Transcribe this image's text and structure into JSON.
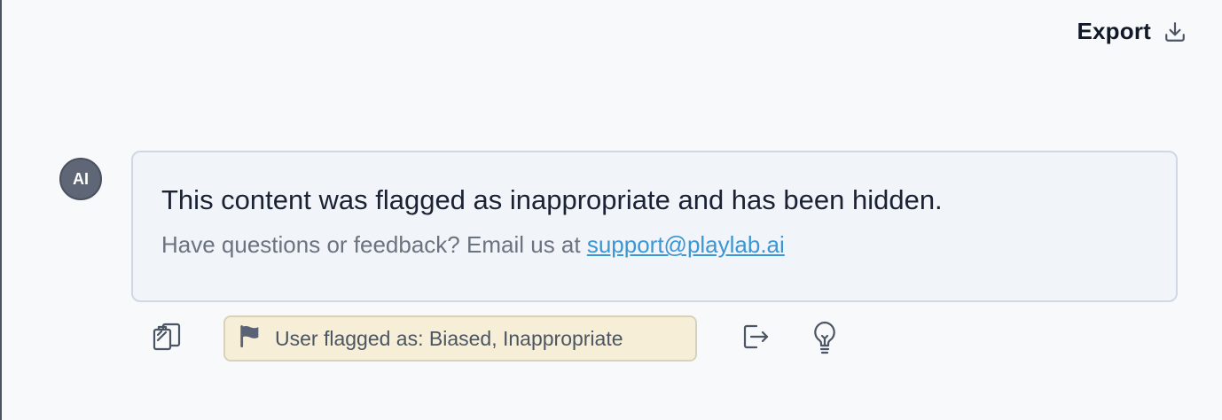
{
  "header": {
    "export_label": "Export",
    "export_icon": "download-icon"
  },
  "message": {
    "avatar_label": "AI",
    "main_text": "This content was flagged as inappropriate and has been hidden.",
    "sub_prefix": "Have questions or feedback? Email us at ",
    "support_email": "support@playlab.ai"
  },
  "actions": {
    "copy_icon": "clipboard-icon",
    "flag_icon": "flag-icon",
    "flag_text": "User flagged as: Biased, Inappropriate",
    "share_icon": "open-in-icon",
    "idea_icon": "lightbulb-icon"
  },
  "colors": {
    "background": "#f8f9fb",
    "card_background": "#f1f4f9",
    "card_border": "#cfd8e3",
    "avatar": "#5f6676",
    "link": "#3b96d4",
    "flag_badge": "#f6eed6"
  }
}
